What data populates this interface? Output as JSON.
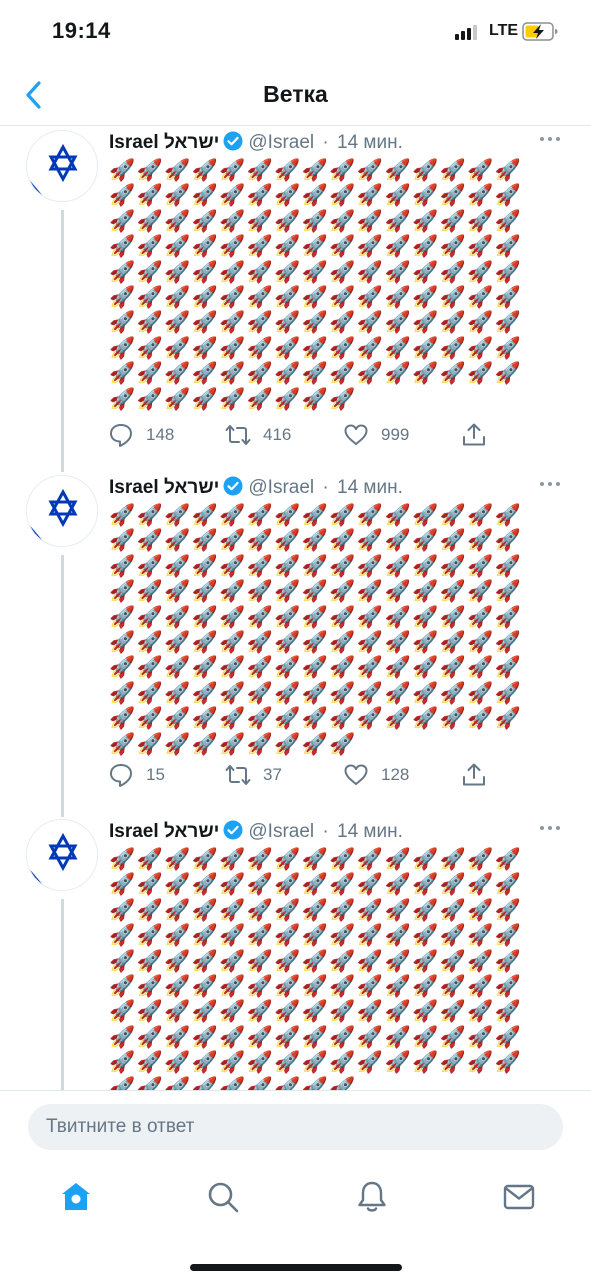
{
  "status_bar": {
    "time": "19:14",
    "network": "LTE",
    "battery_charging": true
  },
  "nav": {
    "title": "Ветка",
    "back_icon": "chevron-left-icon"
  },
  "tweets": [
    {
      "author": "Israel ישראל",
      "handle": "@Israel",
      "time": "14 мин.",
      "verified": true,
      "text": "🚀🚀🚀🚀🚀🚀🚀🚀🚀🚀🚀🚀🚀🚀🚀🚀🚀🚀🚀🚀🚀🚀🚀🚀🚀🚀🚀🚀🚀🚀🚀🚀🚀🚀🚀🚀🚀🚀🚀🚀🚀🚀🚀🚀🚀🚀🚀🚀🚀🚀🚀🚀🚀🚀🚀🚀🚀🚀🚀🚀🚀🚀🚀🚀🚀🚀🚀🚀🚀🚀🚀🚀🚀🚀🚀🚀🚀🚀🚀🚀🚀🚀🚀🚀🚀🚀🚀🚀🚀🚀🚀🚀🚀🚀🚀🚀🚀🚀🚀🚀🚀🚀🚀🚀🚀🚀🚀🚀🚀🚀🚀🚀🚀🚀🚀🚀🚀🚀🚀🚀🚀🚀🚀🚀🚀🚀🚀🚀🚀🚀🚀🚀🚀🚀🚀🚀🚀🚀🚀🚀🚀🚀🚀🚀",
      "replies": "148",
      "retweets": "416",
      "likes": "999"
    },
    {
      "author": "Israel ישראל",
      "handle": "@Israel",
      "time": "14 мин.",
      "verified": true,
      "text": "🚀🚀🚀🚀🚀🚀🚀🚀🚀🚀🚀🚀🚀🚀🚀🚀🚀🚀🚀🚀🚀🚀🚀🚀🚀🚀🚀🚀🚀🚀🚀🚀🚀🚀🚀🚀🚀🚀🚀🚀🚀🚀🚀🚀🚀🚀🚀🚀🚀🚀🚀🚀🚀🚀🚀🚀🚀🚀🚀🚀🚀🚀🚀🚀🚀🚀🚀🚀🚀🚀🚀🚀🚀🚀🚀🚀🚀🚀🚀🚀🚀🚀🚀🚀🚀🚀🚀🚀🚀🚀🚀🚀🚀🚀🚀🚀🚀🚀🚀🚀🚀🚀🚀🚀🚀🚀🚀🚀🚀🚀🚀🚀🚀🚀🚀🚀🚀🚀🚀🚀🚀🚀🚀🚀🚀🚀🚀🚀🚀🚀🚀🚀🚀🚀🚀🚀🚀🚀🚀🚀🚀🚀🚀🚀",
      "replies": "15",
      "retweets": "37",
      "likes": "128"
    },
    {
      "author": "Israel ישראל",
      "handle": "@Israel",
      "time": "14 мин.",
      "verified": true,
      "text": "🚀🚀🚀🚀🚀🚀🚀🚀🚀🚀🚀🚀🚀🚀🚀🚀🚀🚀🚀🚀🚀🚀🚀🚀🚀🚀🚀🚀🚀🚀🚀🚀🚀🚀🚀🚀🚀🚀🚀🚀🚀🚀🚀🚀🚀🚀🚀🚀🚀🚀🚀🚀🚀🚀🚀🚀🚀🚀🚀🚀🚀🚀🚀🚀🚀🚀🚀🚀🚀🚀🚀🚀🚀🚀🚀🚀🚀🚀🚀🚀🚀🚀🚀🚀🚀🚀🚀🚀🚀🚀🚀🚀🚀🚀🚀🚀🚀🚀🚀🚀🚀🚀🚀🚀🚀🚀🚀🚀🚀🚀🚀🚀🚀🚀🚀🚀🚀🚀🚀🚀🚀🚀🚀🚀🚀🚀🚀🚀🚀🚀🚀🚀🚀🚀🚀🚀🚀🚀🚀🚀🚀🚀🚀🚀"
    }
  ],
  "reply_box": {
    "placeholder": "Твитните в ответ"
  },
  "tabs": [
    {
      "name": "home",
      "icon": "home-icon",
      "active": true
    },
    {
      "name": "search",
      "icon": "search-icon",
      "active": false
    },
    {
      "name": "notifications",
      "icon": "bell-icon",
      "active": false
    },
    {
      "name": "messages",
      "icon": "envelope-icon",
      "active": false
    }
  ],
  "colors": {
    "accent": "#1da1f2",
    "text": "#14171a",
    "secondary": "#657786",
    "flag_blue": "#0038b8"
  }
}
